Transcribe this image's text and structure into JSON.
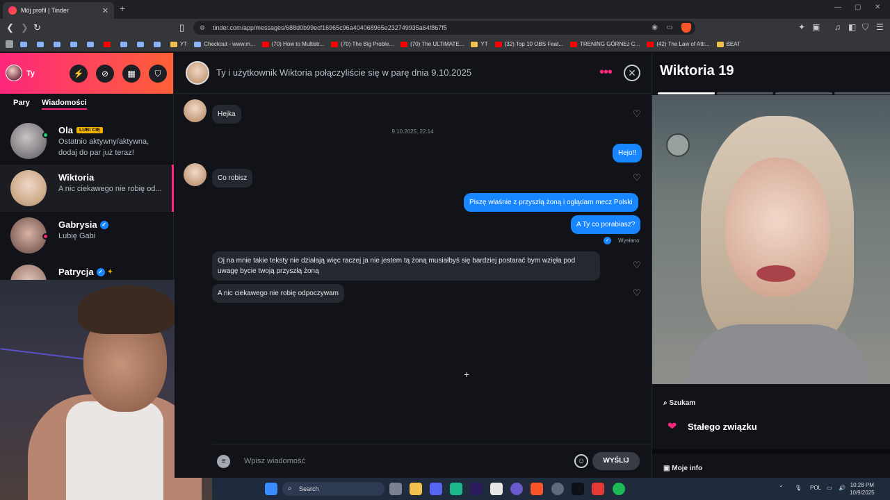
{
  "browser": {
    "tab_title": "Mój profil | Tinder",
    "url": "tinder.com/app/messages/688d0b99ecf16965c96a404068965e232749935a64f867f5",
    "bookmarks": [
      {
        "label": "",
        "kind": "other"
      },
      {
        "label": "",
        "kind": "other"
      },
      {
        "label": "",
        "kind": "other"
      },
      {
        "label": "",
        "kind": "other"
      },
      {
        "label": "",
        "kind": "other"
      },
      {
        "label": "",
        "kind": "yt"
      },
      {
        "label": "",
        "kind": "other"
      },
      {
        "label": "",
        "kind": "other"
      },
      {
        "label": "",
        "kind": "other"
      },
      {
        "label": "YT",
        "kind": "folder"
      },
      {
        "label": "Checkout - www.m...",
        "kind": "other"
      },
      {
        "label": "(70) How to Multistr...",
        "kind": "yt"
      },
      {
        "label": "(70) The Big Proble...",
        "kind": "yt"
      },
      {
        "label": "(70) The ULTIMATE...",
        "kind": "yt"
      },
      {
        "label": "YT",
        "kind": "folder"
      },
      {
        "label": "(32) Top 10 OBS Feat...",
        "kind": "yt"
      },
      {
        "label": "TRENING GÓRNEJ C...",
        "kind": "yt"
      },
      {
        "label": "(42) The Law of Attr...",
        "kind": "yt"
      },
      {
        "label": "BEAT",
        "kind": "folder"
      }
    ]
  },
  "sidebar": {
    "me_label": "Ty",
    "tabs": [
      "Pary",
      "Wiadomości"
    ],
    "conversations": [
      {
        "name": "Ola",
        "badge": "LUBI CIĘ",
        "snippet": "Ostatnio aktywny/aktywna, dodaj do par już teraz!"
      },
      {
        "name": "Wiktoria",
        "snippet": "A nic ciekawego nie robię od..."
      },
      {
        "name": "Gabrysia",
        "snippet": "Lubię Gabi"
      },
      {
        "name": "Patrycja",
        "snippet": ""
      }
    ]
  },
  "chat": {
    "header": "Ty i użytkownik Wiktoria połączyliście się w parę dnia 9.10.2025",
    "timestamp": "9.10.2025, 22:14",
    "messages": [
      {
        "from": "them",
        "text": "Hejka"
      },
      {
        "from": "me",
        "text": "Hejo!!"
      },
      {
        "from": "them",
        "text": "Co robisz"
      },
      {
        "from": "me",
        "text": "Piszę właśnie z przyszłą żoną i oglądam mecz Polski"
      },
      {
        "from": "me",
        "text": "A Ty co porabiasz?"
      },
      {
        "from": "them",
        "text": "Oj na mnie takie teksty nie działają więc raczej ja nie jestem tą żoną musiałbyś się bardziej postarać bym wzięła pod uwagę bycie twoją przyszłą żoną"
      },
      {
        "from": "them",
        "text": "A nic ciekawego nie robię odpoczywam"
      }
    ],
    "sent_status": "Wysłano",
    "input_placeholder": "Wpisz wiadomość",
    "send_label": "WYŚLIJ"
  },
  "profile": {
    "name_age": "Wiktoria 19",
    "looking_label": "Szukam",
    "looking_value": "Stałego związku",
    "info_label": "Moje info"
  },
  "taskbar": {
    "search_label": "Search",
    "language": "POL",
    "time": "10:28 PM",
    "date": "10/9/2025"
  }
}
